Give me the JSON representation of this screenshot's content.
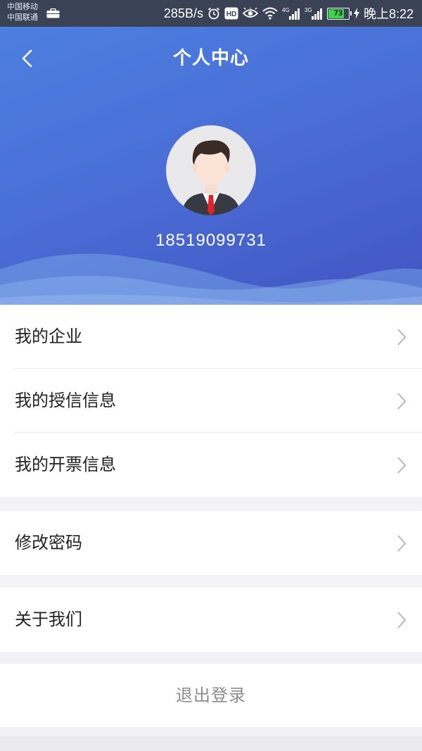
{
  "status_bar": {
    "carrier_1": "中国移动",
    "carrier_2": "中国联通",
    "net_speed": "285B/s",
    "battery": "73",
    "time": "晚上8:22"
  },
  "header": {
    "title": "个人中心",
    "phone": "18519099731"
  },
  "menu": {
    "group1": [
      {
        "label": "我的企业"
      },
      {
        "label": "我的授信信息"
      },
      {
        "label": "我的开票信息"
      }
    ],
    "group2": [
      {
        "label": "修改密码"
      }
    ],
    "group3": [
      {
        "label": "关于我们"
      }
    ]
  },
  "logout_label": "退出登录",
  "colors": {
    "header_start": "#4c7fe0",
    "header_end": "#4254c2",
    "battery_fill": "#3ed34c",
    "tie": "#e0232b"
  },
  "icons": [
    "briefcase-icon",
    "alarm-icon",
    "hd-icon",
    "eye-icon",
    "wifi-icon",
    "signal-4g-icon",
    "signal-3g-icon",
    "battery-icon",
    "charging-icon",
    "back-arrow-icon",
    "avatar-icon",
    "chevron-right-icon"
  ]
}
